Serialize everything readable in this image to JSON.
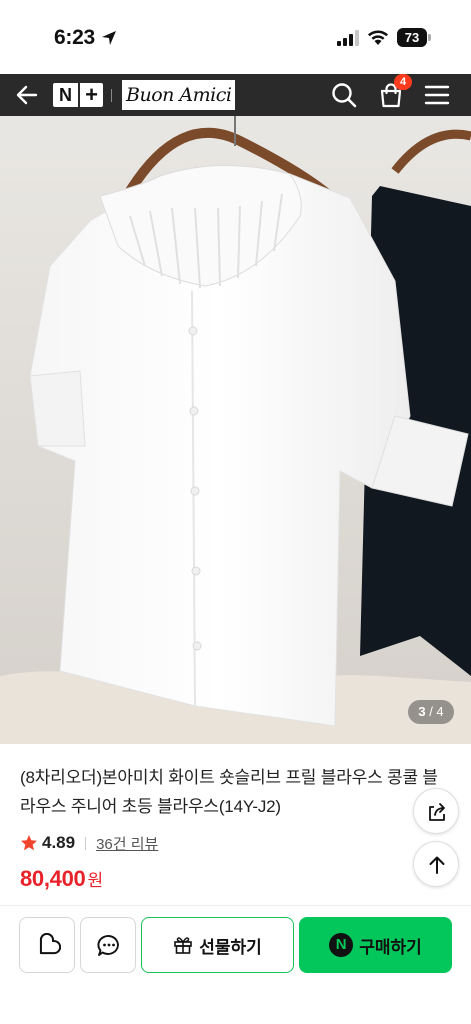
{
  "status_bar": {
    "time": "6:23",
    "battery": "73"
  },
  "header": {
    "brand_badge_left": "N",
    "brand_badge_right": "+",
    "store_logo": "Buon Amici",
    "cart_count": "4",
    "icons": [
      "back-arrow-icon",
      "search-icon",
      "cart-icon",
      "menu-icon"
    ]
  },
  "gallery": {
    "current": "3",
    "total": "/ 4"
  },
  "product": {
    "title": "(8차리오더)본아미치 화이트 숏슬리브 프릴 블라우스 콩쿨 블라우스 주니어 초등 블라우스(14Y-J2)",
    "rating": "4.89",
    "review_link": "36건 리뷰",
    "price": "80,400",
    "price_unit": "원"
  },
  "actions": {
    "gift_label": "선물하기",
    "buy_label": "구매하기",
    "buy_badge": "N"
  },
  "colors": {
    "header_bg": "#2a2a2a",
    "price": "#e8222a",
    "naver_green": "#03c75a",
    "badge": "#ff3b1f",
    "star": "#f0442d"
  }
}
